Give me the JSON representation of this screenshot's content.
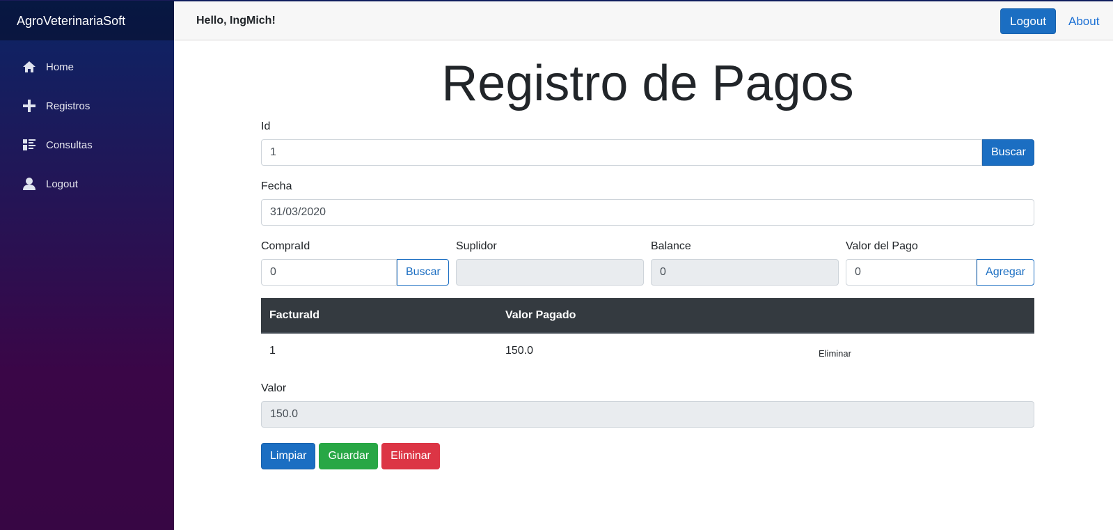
{
  "app": {
    "brand": "AgroVeterinariaSoft"
  },
  "sidebar": {
    "items": [
      {
        "label": "Home",
        "icon": "home-icon"
      },
      {
        "label": "Registros",
        "icon": "plus-icon"
      },
      {
        "label": "Consultas",
        "icon": "list-icon"
      },
      {
        "label": "Logout",
        "icon": "person-icon"
      }
    ]
  },
  "header": {
    "greeting": "Hello, IngMich!",
    "logout_label": "Logout",
    "about_label": "About"
  },
  "form": {
    "title": "Registro de Pagos",
    "id_label": "Id",
    "id_value": "1",
    "id_search_label": "Buscar",
    "fecha_label": "Fecha",
    "fecha_value": "31/03/2020",
    "compra_label": "CompraId",
    "compra_value": "0",
    "compra_search_label": "Buscar",
    "suplidor_label": "Suplidor",
    "suplidor_value": "",
    "balance_label": "Balance",
    "balance_value": "0",
    "valor_pago_label": "Valor del Pago",
    "valor_pago_value": "0",
    "agregar_label": "Agregar",
    "valor_label": "Valor",
    "valor_value": "150.0"
  },
  "table": {
    "headers": [
      "FacturaId",
      "Valor Pagado",
      ""
    ],
    "rows": [
      {
        "factura_id": "1",
        "valor_pagado": "150.0",
        "action": "Eliminar"
      }
    ]
  },
  "actions": {
    "limpiar": "Limpiar",
    "guardar": "Guardar",
    "eliminar": "Eliminar"
  },
  "colors": {
    "primary": "#1b6ec2",
    "success": "#28a745",
    "danger": "#dc3545",
    "table_header": "#343a40"
  }
}
